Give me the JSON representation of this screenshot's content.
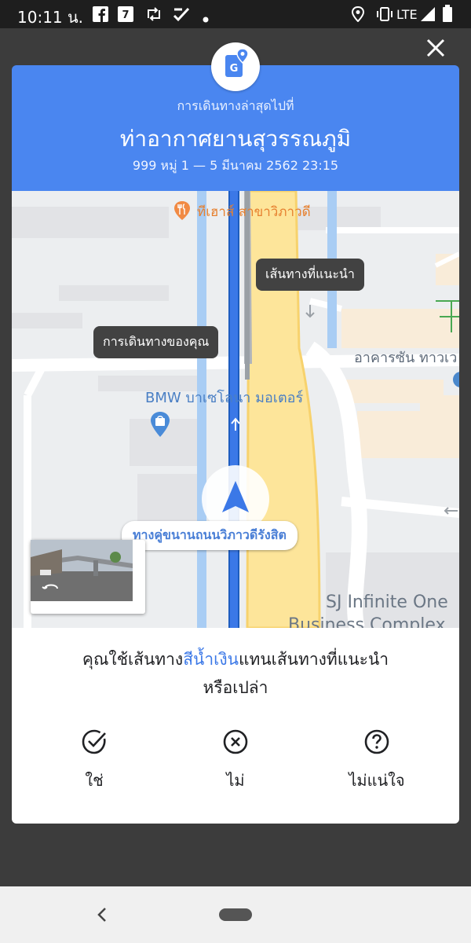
{
  "status_bar": {
    "time": "10:11 น.",
    "network": "LTE",
    "icons": [
      "facebook-icon",
      "seven-eleven-icon",
      "retweet-icon",
      "check-app-icon",
      "dot-icon",
      "location-icon",
      "vibrate-icon",
      "signal-icon",
      "battery-icon"
    ]
  },
  "header": {
    "subtitle": "การเดินทางล่าสุดไปที่",
    "title": "ท่าอากาศยานสุวรรณภูมิ",
    "address": "999 หมู่ 1 — 5 มีนาคม 2562 23:15",
    "color": "#4a86f0"
  },
  "map": {
    "labels": {
      "restaurant": "ทีเฮาส์ สาขาวิภาวดี",
      "shop": "BMW บาเซโลนา มอเตอร์",
      "building_right": "อาคารซัน ทาวเว",
      "complex_line1": "SJ Infinite One",
      "complex_line2": "Business Complex"
    },
    "tooltip_suggested": "เส้นทางที่แนะนำ",
    "tooltip_yours": "การเดินทางของคุณ",
    "road_label": "ทางคู่ขนานถนนวิภาวดีรังสิต",
    "route_color": "#3b78e7",
    "highway_color": "#fde59a"
  },
  "question": {
    "part1": "คุณใช้เส้นทาง",
    "highlight": "สีน้ำเงิน",
    "part2": "แทนเส้นทางที่แนะนำ",
    "line2": "หรือเปล่า"
  },
  "answers": {
    "yes": "ใช่",
    "no": "ไม่",
    "unsure": "ไม่แน่ใจ"
  }
}
